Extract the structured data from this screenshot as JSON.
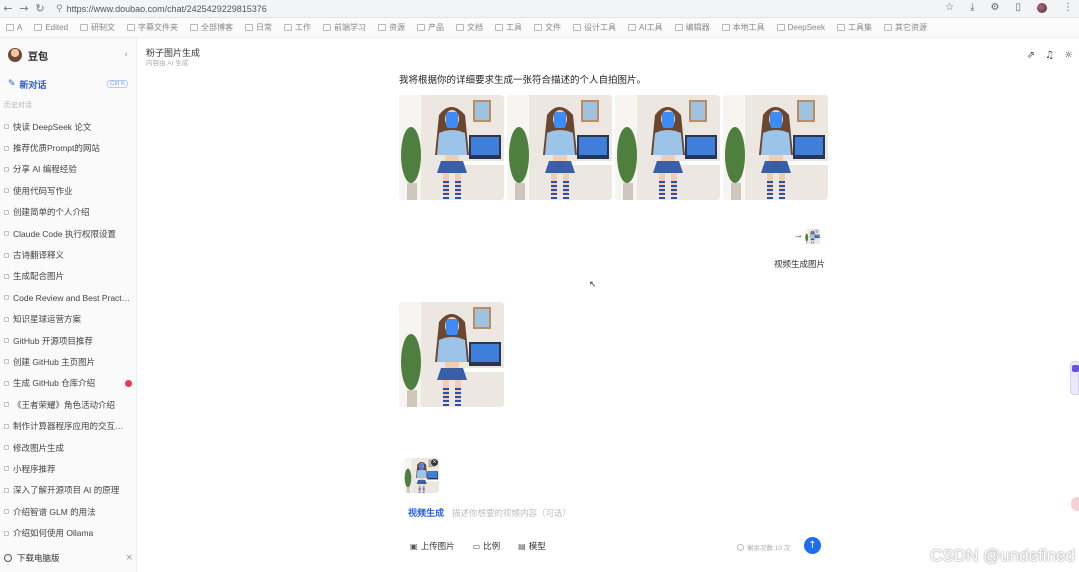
{
  "browser": {
    "url": "https://www.doubao.com/chat/2425429229815376",
    "bookmarks": [
      "A",
      "Edited",
      "研制文",
      "字幕文件夹",
      "全部博客",
      "日常",
      "工作",
      "前端学习",
      "资源",
      "产品",
      "文档",
      "工具",
      "文件",
      "设计工具",
      "AI工具",
      "编辑器",
      "本地工具",
      "DeepSeek",
      "工具集",
      "其它资源"
    ]
  },
  "sidebar": {
    "app_name": "豆包",
    "new_chat": "新对话",
    "new_chat_shortcut": "Ctrl K",
    "section_label": "历史对话",
    "items": [
      {
        "label": "快读 DeepSeek 论文",
        "badge": false
      },
      {
        "label": "推荐优质Prompt的网站",
        "badge": false
      },
      {
        "label": "分享 AI 编程经验",
        "badge": false
      },
      {
        "label": "使用代码写作业",
        "badge": false
      },
      {
        "label": "创建简单的个人介绍",
        "badge": false
      },
      {
        "label": "Claude Code 执行权限设置",
        "badge": false
      },
      {
        "label": "古诗翻译释义",
        "badge": false
      },
      {
        "label": "生成配合图片",
        "badge": false
      },
      {
        "label": "Code Review and Best Practices",
        "badge": false
      },
      {
        "label": "知识星球运营方案",
        "badge": false
      },
      {
        "label": "GitHub 开源项目推荐",
        "badge": false
      },
      {
        "label": "创建 GitHub 主页图片",
        "badge": false
      },
      {
        "label": "生成 GitHub 仓库介绍",
        "badge": true
      },
      {
        "label": "《王者荣耀》角色活动介绍",
        "badge": false
      },
      {
        "label": "制作计算器程序应用的交互式页面",
        "badge": false
      },
      {
        "label": "修改图片生成",
        "badge": false
      },
      {
        "label": "小程序推荐",
        "badge": false
      },
      {
        "label": "深入了解开源项目 AI 的原理",
        "badge": false
      },
      {
        "label": "介绍智谱 GLM 的用法",
        "badge": false
      },
      {
        "label": "介绍如何使用 Ollama",
        "badge": false
      }
    ],
    "download_label": "下载电脑版"
  },
  "main": {
    "conversation_title": "粉子图片生成",
    "conversation_subtitle": "内容由 AI 生成",
    "prompt_text": "我将根据你的详细要求生成一张符合描述的个人自拍图片。",
    "user_caption": "视频生成图片",
    "composer": {
      "mode_tag": "视频生成",
      "placeholder": "描述你想要的视频内容（可选）",
      "tools": [
        {
          "icon": "image-icon",
          "label": "上传图片"
        },
        {
          "icon": "ratio-icon",
          "label": "比例"
        },
        {
          "icon": "style-icon",
          "label": "模型"
        }
      ],
      "counter": "剩余次数 10 次"
    }
  },
  "watermark": "CSDN @undefined",
  "colors": {
    "accent": "#1e6cf0",
    "badge": "#e8364e",
    "sidebar_bg": "#fafafa"
  }
}
